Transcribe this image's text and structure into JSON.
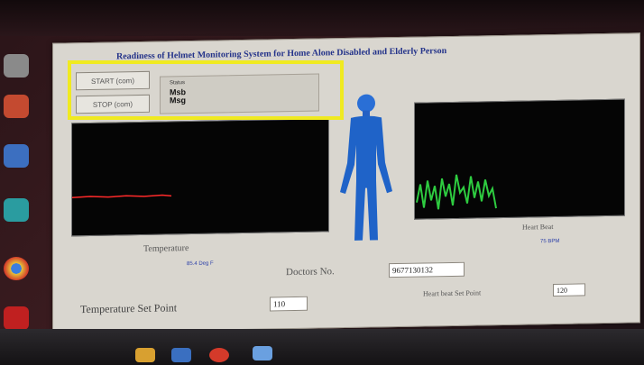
{
  "window": {
    "title": "Readiness of Helmet Monitoring System for Home Alone Disabled and Elderly Person"
  },
  "controls": {
    "start_label": "START (com)",
    "stop_label": "STOP (com)",
    "status_label": "Status",
    "status_line1": "Msb",
    "status_line2": "Msg"
  },
  "temperature": {
    "label": "Temperature",
    "value_text": "85.4 Deg F",
    "set_point_label": "Temperature Set Point",
    "set_point_value": "110"
  },
  "doctors": {
    "label": "Doctors No.",
    "value": "9677130132"
  },
  "heart": {
    "label": "Heart Beat",
    "value_text": "75 BPM",
    "set_point_label": "Heart beat Set Point",
    "set_point_value": "120"
  },
  "colors": {
    "temp_trace": "#ff2a2a",
    "heart_trace": "#2ecc40",
    "highlight": "#f0ea20",
    "body": "#1f63c8"
  }
}
